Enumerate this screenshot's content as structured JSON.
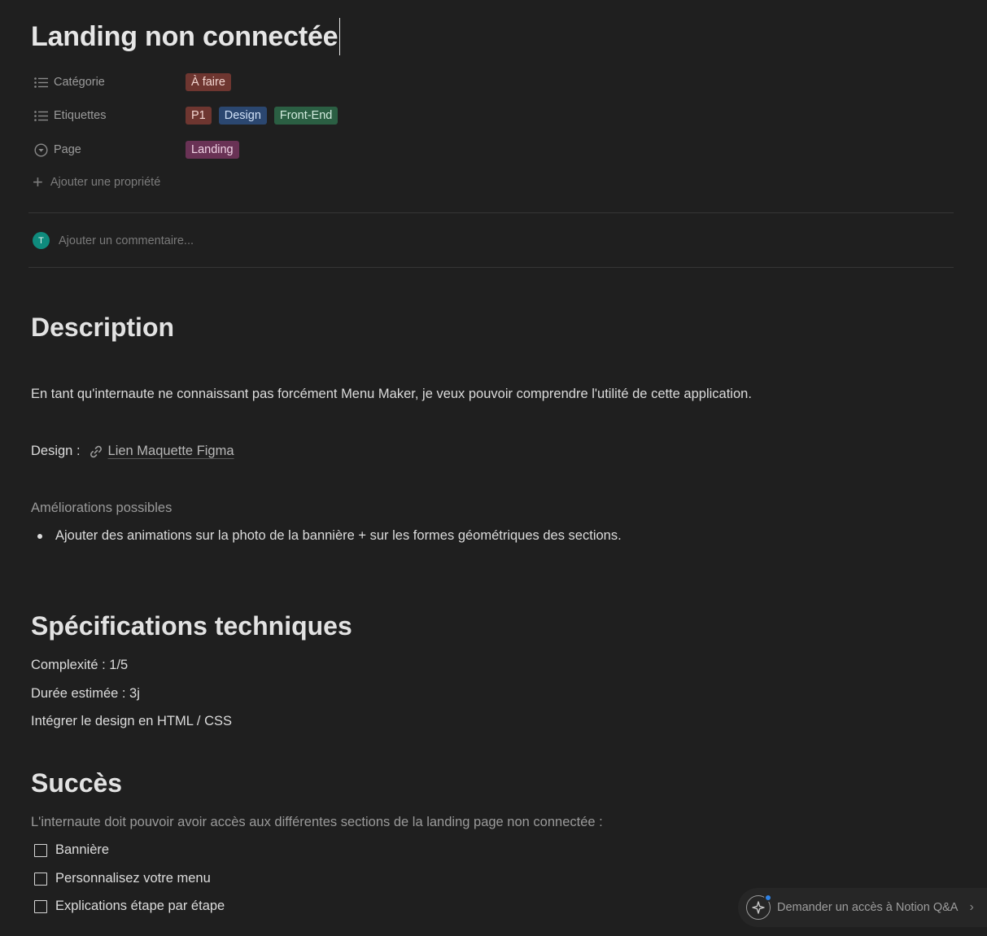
{
  "page": {
    "title": "Landing non connectée"
  },
  "properties": [
    {
      "name": "Catégorie",
      "icon": "list-icon",
      "tags": [
        {
          "label": "À faire",
          "color": "#6e3630"
        }
      ]
    },
    {
      "name": "Etiquettes",
      "icon": "list-icon",
      "tags": [
        {
          "label": "P1",
          "color": "#6e3630"
        },
        {
          "label": "Design",
          "color": "#2b4770"
        },
        {
          "label": "Front-End",
          "color": "#2b5f43"
        }
      ]
    },
    {
      "name": "Page",
      "icon": "select-circle-icon",
      "tags": [
        {
          "label": "Landing",
          "color": "#693255"
        }
      ]
    }
  ],
  "add_property_label": "Ajouter une propriété",
  "comment": {
    "avatar_initial": "T",
    "avatar_color": "#0f8b7d",
    "placeholder": "Ajouter un commentaire..."
  },
  "description": {
    "heading": "Description",
    "intro": "En tant qu'internaute ne connaissant pas forcément Menu Maker, je veux pouvoir comprendre l'utilité de cette application.",
    "design_label": "Design :",
    "design_link": "Lien Maquette Figma",
    "improvements_label": "Améliorations possibles",
    "improvements": [
      "Ajouter des animations sur la photo de la bannière + sur les formes géométriques des sections."
    ]
  },
  "specs": {
    "heading": "Spécifications techniques",
    "lines": [
      "Complexité : 1/5",
      "Durée estimée : 3j",
      "Intégrer le design en HTML / CSS"
    ]
  },
  "success": {
    "heading": "Succès",
    "intro": "L'internaute doit pouvoir avoir accès aux différentes sections de la landing page non connectée :",
    "todos": [
      "Bannière",
      "Personnalisez votre menu",
      "Explications étape par étape"
    ]
  },
  "qa_button": {
    "label": "Demander un accès à Notion Q&A",
    "accent": "#2f83e6"
  }
}
